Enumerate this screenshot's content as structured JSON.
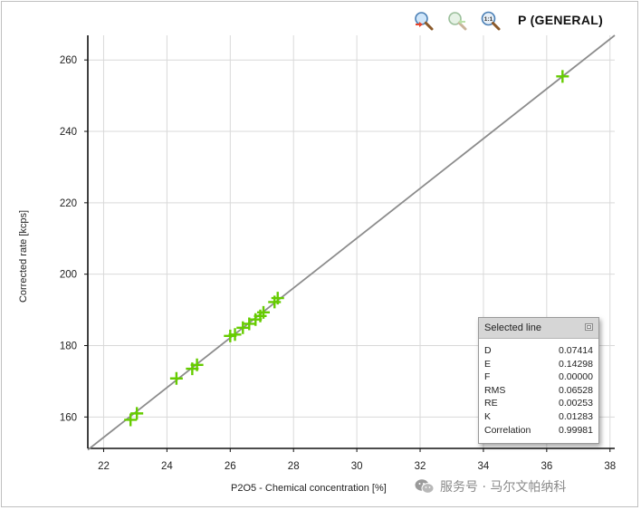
{
  "chart_data": {
    "type": "scatter",
    "title": "P (GENERAL)",
    "xlabel": "P2O5 - Chemical concentration [%]",
    "ylabel": "Corrected rate [kcps]",
    "xlim": [
      21.5,
      38.15
    ],
    "ylim": [
      151.2,
      266.9
    ],
    "xticks": [
      22,
      24,
      26,
      28,
      30,
      32,
      34,
      36,
      38
    ],
    "yticks": [
      160,
      180,
      200,
      220,
      240,
      260
    ],
    "grid": true,
    "series": [
      {
        "color": "#66cc00",
        "marker": "plus",
        "points": [
          [
            22.85,
            159.2
          ],
          [
            23.05,
            161.0
          ],
          [
            24.3,
            170.8
          ],
          [
            24.8,
            173.5
          ],
          [
            24.95,
            174.6
          ],
          [
            26.0,
            182.7
          ],
          [
            26.15,
            183.1
          ],
          [
            26.4,
            185.0
          ],
          [
            26.6,
            186.1
          ],
          [
            26.8,
            187.3
          ],
          [
            26.95,
            188.3
          ],
          [
            27.05,
            189.3
          ],
          [
            27.4,
            192.2
          ],
          [
            27.5,
            193.3
          ],
          [
            36.5,
            255.4
          ]
        ]
      }
    ],
    "fit_line": {
      "color": "#8c8c8c",
      "points": [
        [
          21.5,
          150.8
        ],
        [
          38.15,
          266.9
        ]
      ]
    }
  },
  "toolbar": {
    "tools": [
      {
        "icon": "zoom-in-icon"
      },
      {
        "icon": "zoom-out-icon"
      },
      {
        "icon": "zoom-reset-icon",
        "text": "1:1"
      }
    ]
  },
  "panel": {
    "title": "Selected line",
    "rows": [
      {
        "label": "D",
        "value": "0.07414"
      },
      {
        "label": "E",
        "value": "0.14298"
      },
      {
        "label": "F",
        "value": "0.00000"
      },
      {
        "label": "RMS",
        "value": "0.06528"
      },
      {
        "label": "RE",
        "value": "0.00253"
      },
      {
        "label": "K",
        "value": "0.01283"
      },
      {
        "label": "Correlation",
        "value": "0.99981"
      }
    ]
  },
  "watermark": {
    "text": "服务号 · 马尔文帕纳科"
  }
}
